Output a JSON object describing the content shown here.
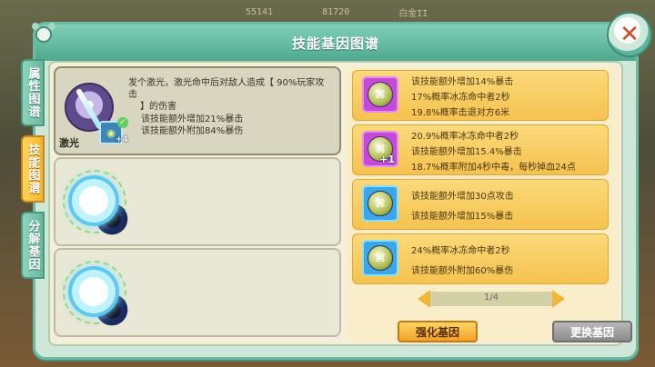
{
  "topbar": {
    "stats": [
      "55141",
      "81720",
      "白金II"
    ]
  },
  "window": {
    "title": "技能基因图谱",
    "close_icon": "close-icon",
    "accent": "#6fb9a3"
  },
  "tabs": [
    {
      "label": "属性图谱",
      "active": false
    },
    {
      "label": "技能图谱",
      "active": true
    },
    {
      "label": "分解基因",
      "active": false
    }
  ],
  "skill": {
    "name": "激光",
    "description_line1": "发个激光，激光命中后对敌人造成【 90%玩家攻击",
    "description_line2": "】的伤害",
    "effect1": "该技能额外增加21%暴击",
    "effect2": "该技能额外附加84%暴伤",
    "badge": "+4",
    "check_icon": "✓"
  },
  "slots": [
    {
      "state": "empty"
    },
    {
      "state": "empty"
    }
  ],
  "genes": [
    {
      "frame": "purple",
      "plus": "",
      "lines": [
        "该技能额外增加14%暴击",
        "17%概率冰冻命中者2秒",
        "19.8%概率击退对方6米"
      ]
    },
    {
      "frame": "purple",
      "plus": "+1",
      "lines": [
        "20.9%概率冰冻命中者2秒",
        "该技能额外增加15.4%暴击",
        "18.7%概率附加4秒中毒，每秒掉血24点"
      ]
    },
    {
      "frame": "blue",
      "plus": "",
      "lines": [
        "该技能额外增加30点攻击",
        "该技能额外增加15%暴击"
      ]
    },
    {
      "frame": "blue",
      "plus": "",
      "lines": [
        "24%概率冰冻命中者2秒",
        "该技能额外附加60%暴伤"
      ]
    }
  ],
  "pager": {
    "text": "1/4"
  },
  "buttons": {
    "enhance": "强化基因",
    "replace": "更换基因"
  }
}
